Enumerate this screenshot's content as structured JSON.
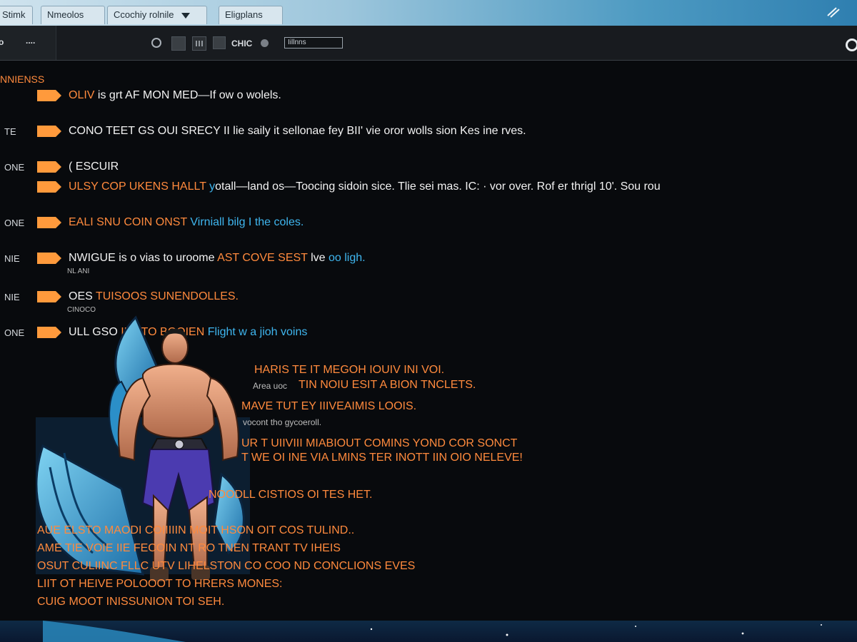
{
  "tabs": [
    "Stimk",
    "Nmeolos",
    "Ccochiy rolnile",
    "Eligplans"
  ],
  "toolbar": {
    "dots": "....",
    "label": "CHIC",
    "search_value": "Iillnns"
  },
  "sidebar_title": "NNIENSS",
  "rows": [
    {
      "side": "",
      "parts": [
        {
          "t": "OLIV",
          "c": "or"
        },
        {
          "t": "  is grt AF MON MED—If ow o wolels.",
          "c": "wh"
        }
      ]
    },
    {
      "side": "TE",
      "parts": [
        {
          "t": "CONO TEET GS OUI SRECY II lie saily it sellonae fey BII'  vie oror wolls sion Kes ine rves.",
          "c": "wh"
        }
      ]
    },
    {
      "side": "ONE",
      "parts": [
        {
          "t": "( ESCUIR",
          "c": "wh"
        }
      ]
    },
    {
      "side": "",
      "parts": [
        {
          "t": "ULSY COP UKENS HALLT  ",
          "c": "or"
        },
        {
          "t": "y",
          "c": "bl"
        },
        {
          "t": "otall—land os—Toocing sidoin sice. Tlie sei mas. IC: · vor over. Rof er thrigl 10'. Sou rou",
          "c": "wh"
        }
      ]
    },
    {
      "side": "ONE",
      "parts": [
        {
          "t": "EALI SNU COIN ONST ",
          "c": "or"
        },
        {
          "t": "Virniall bilg I the coles.",
          "c": "bl"
        }
      ]
    },
    {
      "side": "NIE",
      "parts": [
        {
          "t": "NWIGUE",
          "c": "wh"
        },
        {
          "t": "              is o vias to uroome ",
          "c": "wh"
        },
        {
          "t": "AST COVE SEST ",
          "c": "or"
        },
        {
          "t": "lve ",
          "c": "wh"
        },
        {
          "t": "oo ligh.",
          "c": "bl"
        }
      ]
    },
    {
      "side": "NIE",
      "parts": [
        {
          "t": "OES",
          "c": "wh"
        },
        {
          "t": "                             TUISOOS SUNENDOLLES.",
          "c": "or"
        }
      ]
    },
    {
      "side": "ONE",
      "parts": [
        {
          "t": "ULL GSO",
          "c": "wh"
        },
        {
          "t": "                       INOTO BOOIEN ",
          "c": "or"
        },
        {
          "t": "Flight w a jioh voins",
          "c": "bl"
        }
      ]
    }
  ],
  "row_subs": [
    "NL ANI",
    "CINOCO"
  ],
  "block": [
    "HARIS TE IT MEGOH IOUIV INI VOI.",
    "TIN NOIU ESIT A BION TNCLETS.",
    "MAVE TUT EY IIIVEAIMIS LOOIS.",
    "UR T UIIVIII MIABIOUT COMINS YOND COR SONCT",
    "T WE OI INE VIA LMINS TER INOTT IIN OIO NELEVE!",
    "NOODLL CISTIOS OI TES HET."
  ],
  "block_subs": [
    "Area uoc",
    "vocont tho gycoeroll."
  ],
  "bottom": [
    "AUE ELSTO MAODI COIIIIIN MOIT HSON OIT COS TULIND..",
    "AME  TIE  VOIE IIE  FECOIN NT RO TNEN TRANT TV IHEIS",
    "OSUT CULIINC FLLC UTV LIHELSTON  CO COO ND CONCLIONS EVES",
    "LIIT OT HEIVE POLOOOT TO HRERS MONES:",
    "CUIG MOOT INISSUNION TOI SEH."
  ]
}
